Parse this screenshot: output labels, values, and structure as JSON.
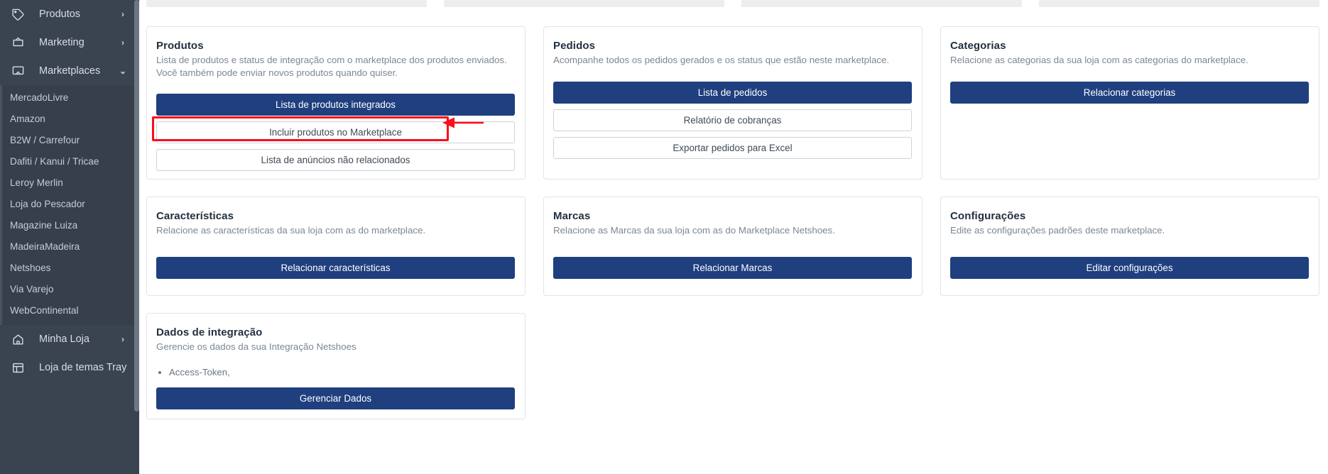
{
  "sidebar": {
    "top_items": [
      {
        "label": "Produtos",
        "icon": "tag-icon",
        "chevron": "›"
      },
      {
        "label": "Marketing",
        "icon": "megaphone-icon",
        "chevron": "›"
      },
      {
        "label": "Marketplaces",
        "icon": "monitor-icon",
        "chevron": "⌄"
      }
    ],
    "submenu": [
      {
        "label": "MercadoLivre"
      },
      {
        "label": "Amazon"
      },
      {
        "label": "B2W / Carrefour"
      },
      {
        "label": "Dafiti / Kanui / Tricae"
      },
      {
        "label": "Leroy Merlin"
      },
      {
        "label": "Loja do Pescador"
      },
      {
        "label": "Magazine Luiza"
      },
      {
        "label": "MadeiraMadeira"
      },
      {
        "label": "Netshoes"
      },
      {
        "label": "Via Varejo"
      },
      {
        "label": "WebContinental"
      }
    ],
    "bottom_items": [
      {
        "label": "Minha Loja",
        "icon": "home-icon",
        "chevron": "›"
      },
      {
        "label": "Loja de temas Tray",
        "icon": "layout-icon",
        "chevron": ""
      }
    ]
  },
  "cards": {
    "produtos": {
      "title": "Produtos",
      "desc": "Lista de produtos e status de integração com o marketplace dos produtos enviados. Você também pode enviar novos produtos quando quiser.",
      "btn_primary": "Lista de produtos integrados",
      "btn_highlight": "Incluir produtos no Marketplace",
      "btn_outline": "Lista de anúncios não relacionados"
    },
    "pedidos": {
      "title": "Pedidos",
      "desc": "Acompanhe todos os pedidos gerados e os status que estão neste marketplace.",
      "btn_primary": "Lista de pedidos",
      "btn_outline_1": "Relatório de cobranças",
      "btn_outline_2": "Exportar pedidos para Excel"
    },
    "categorias": {
      "title": "Categorias",
      "desc": "Relacione as categorias da sua loja com as categorias do marketplace.",
      "btn_primary": "Relacionar categorias"
    },
    "caracteristicas": {
      "title": "Características",
      "desc": "Relacione as características da sua loja com as do marketplace.",
      "btn_primary": "Relacionar características"
    },
    "marcas": {
      "title": "Marcas",
      "desc": "Relacione as Marcas da sua loja com as do Marketplace Netshoes.",
      "btn_primary": "Relacionar Marcas"
    },
    "configuracoes": {
      "title": "Configurações",
      "desc": "Edite as configurações padrões deste marketplace.",
      "btn_primary": "Editar configurações"
    },
    "dados": {
      "title": "Dados de integração",
      "desc": "Gerencie os dados da sua Integração Netshoes",
      "bullets": [
        "Access-Token,"
      ],
      "btn_primary": "Gerenciar Dados"
    }
  },
  "annotation": {
    "highlight_color": "#fc0d1b",
    "target": "Incluir produtos no Marketplace"
  },
  "colors": {
    "sidebar_bg": "#3a4350",
    "submenu_bg": "#373f4b",
    "primary_button": "#1f3f7f",
    "card_border": "#e2e4e7",
    "annotation_red": "#fc0d1b"
  }
}
